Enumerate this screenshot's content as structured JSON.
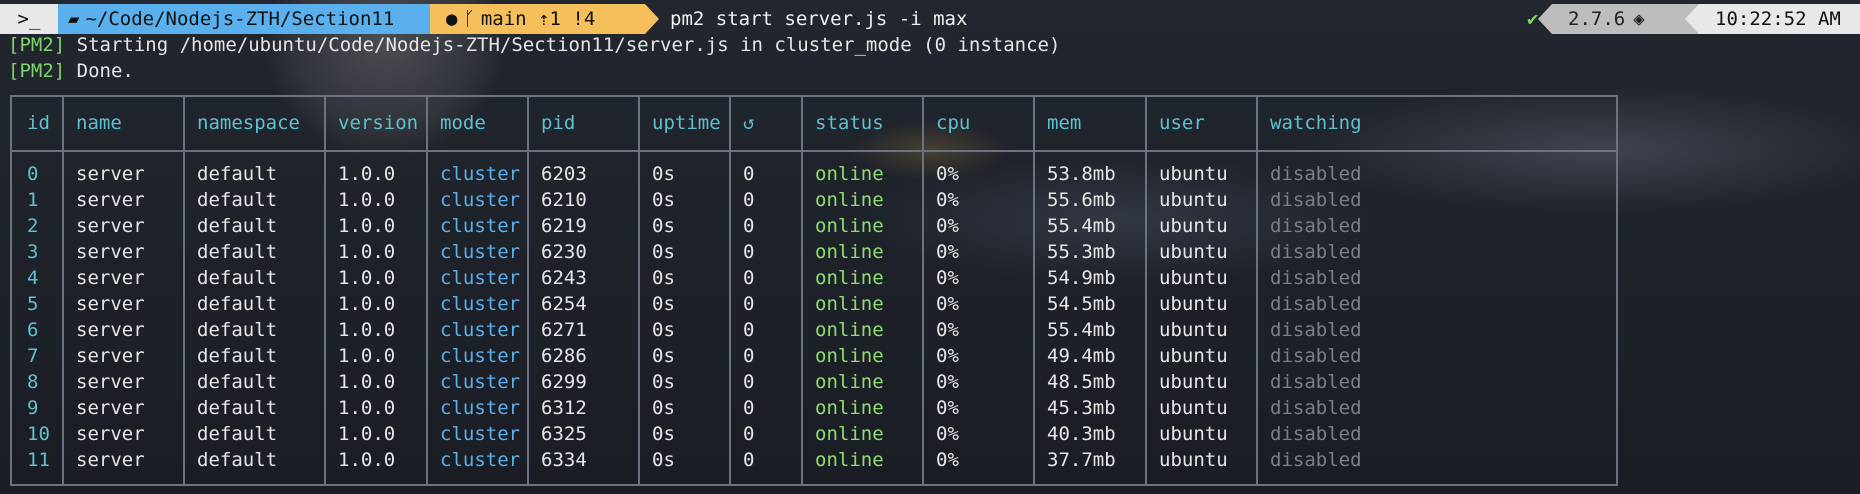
{
  "prompt": {
    "os_icon": "terminal-icon",
    "path": "~/Code/Nodejs-ZTH/Section11",
    "git_branch": "main",
    "git_ahead": "⇡1",
    "git_modified": "!4",
    "command": "pm2 start server.js -i max",
    "status_mark": "✔",
    "version": "2.7.6",
    "time": "10:22:52 AM"
  },
  "output": {
    "line1_tag": "[PM2]",
    "line1_text": " Starting /home/ubuntu/Code/Nodejs-ZTH/Section11/server.js in cluster_mode (0 instance)",
    "line2_tag": "[PM2]",
    "line2_text": " Done."
  },
  "table": {
    "headers": [
      "id",
      "name",
      "namespace",
      "version",
      "mode",
      "pid",
      "uptime",
      "↺",
      "status",
      "cpu",
      "mem",
      "user",
      "watching"
    ],
    "rows": [
      [
        "0",
        "server",
        "default",
        "1.0.0",
        "cluster",
        "6203",
        "0s",
        "0",
        "online",
        "0%",
        "53.8mb",
        "ubuntu",
        "disabled"
      ],
      [
        "1",
        "server",
        "default",
        "1.0.0",
        "cluster",
        "6210",
        "0s",
        "0",
        "online",
        "0%",
        "55.6mb",
        "ubuntu",
        "disabled"
      ],
      [
        "2",
        "server",
        "default",
        "1.0.0",
        "cluster",
        "6219",
        "0s",
        "0",
        "online",
        "0%",
        "55.4mb",
        "ubuntu",
        "disabled"
      ],
      [
        "3",
        "server",
        "default",
        "1.0.0",
        "cluster",
        "6230",
        "0s",
        "0",
        "online",
        "0%",
        "55.3mb",
        "ubuntu",
        "disabled"
      ],
      [
        "4",
        "server",
        "default",
        "1.0.0",
        "cluster",
        "6243",
        "0s",
        "0",
        "online",
        "0%",
        "54.9mb",
        "ubuntu",
        "disabled"
      ],
      [
        "5",
        "server",
        "default",
        "1.0.0",
        "cluster",
        "6254",
        "0s",
        "0",
        "online",
        "0%",
        "54.5mb",
        "ubuntu",
        "disabled"
      ],
      [
        "6",
        "server",
        "default",
        "1.0.0",
        "cluster",
        "6271",
        "0s",
        "0",
        "online",
        "0%",
        "55.4mb",
        "ubuntu",
        "disabled"
      ],
      [
        "7",
        "server",
        "default",
        "1.0.0",
        "cluster",
        "6286",
        "0s",
        "0",
        "online",
        "0%",
        "49.4mb",
        "ubuntu",
        "disabled"
      ],
      [
        "8",
        "server",
        "default",
        "1.0.0",
        "cluster",
        "6299",
        "0s",
        "0",
        "online",
        "0%",
        "48.5mb",
        "ubuntu",
        "disabled"
      ],
      [
        "9",
        "server",
        "default",
        "1.0.0",
        "cluster",
        "6312",
        "0s",
        "0",
        "online",
        "0%",
        "45.3mb",
        "ubuntu",
        "disabled"
      ],
      [
        "10",
        "server",
        "default",
        "1.0.0",
        "cluster",
        "6325",
        "0s",
        "0",
        "online",
        "0%",
        "40.3mb",
        "ubuntu",
        "disabled"
      ],
      [
        "11",
        "server",
        "default",
        "1.0.0",
        "cluster",
        "6334",
        "0s",
        "0",
        "online",
        "0%",
        "37.7mb",
        "ubuntu",
        "disabled"
      ]
    ]
  },
  "colors": {
    "accent_blue": "#5ab0ec",
    "git_yellow": "#f5c05b",
    "status_green": "#8ede6f",
    "header_cyan": "#5fc1cf"
  }
}
